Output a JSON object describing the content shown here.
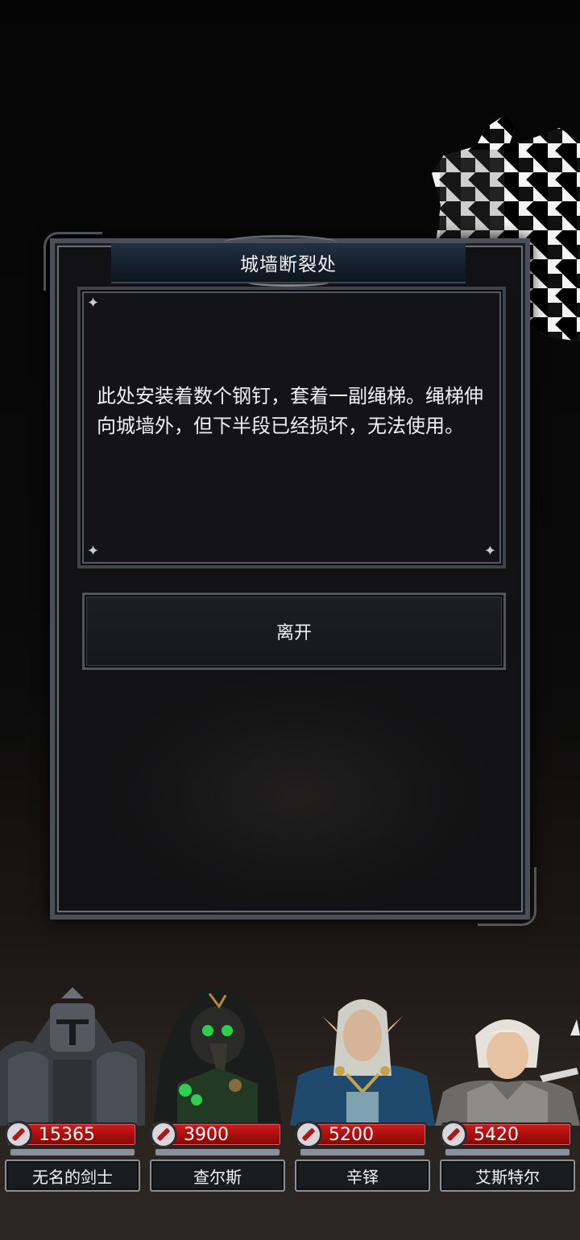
{
  "dialog": {
    "title": "城墙断裂处",
    "description": "此处安装着数个钢钉，套着一副绳梯。绳梯伸向城墙外，但下半段已经损坏，无法使用。",
    "leave_label": "离开"
  },
  "party": [
    {
      "name": "无名的剑士",
      "hp": "15365",
      "portrait_icon": "armored-knight-portrait"
    },
    {
      "name": "查尔斯",
      "hp": "3900",
      "portrait_icon": "plague-doctor-portrait"
    },
    {
      "name": "辛铎",
      "hp": "5200",
      "portrait_icon": "elf-mage-portrait"
    },
    {
      "name": "艾斯特尔",
      "hp": "5420",
      "portrait_icon": "young-swordsman-portrait"
    }
  ],
  "colors": {
    "hp_bar": "#b31212",
    "frame": "#4b4f57",
    "title_bar": "#162230"
  }
}
